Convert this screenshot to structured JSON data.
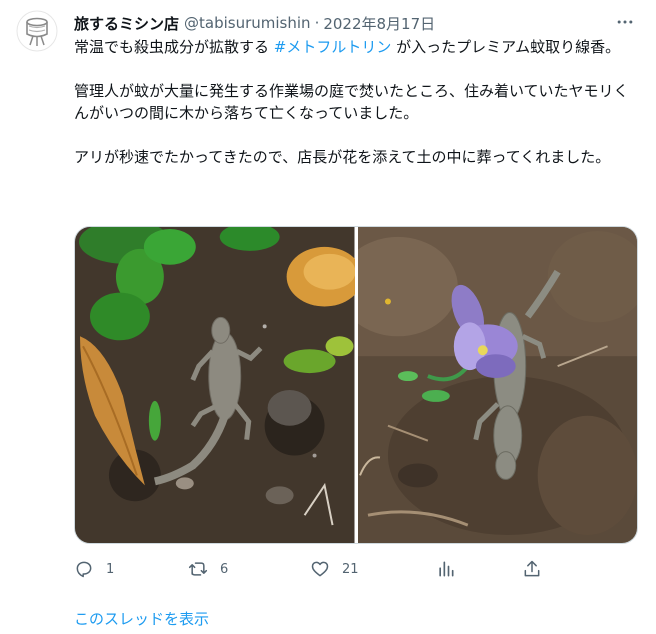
{
  "tweet": {
    "author": {
      "display_name": "旅するミシン店",
      "handle": "@tabisurumishin",
      "avatar_icon": "sewing-machine-logo-icon"
    },
    "separator": "·",
    "date": "2022年8月17日",
    "more_icon": "more-dots-icon",
    "text": {
      "p1_before": "常温でも殺虫成分が拡散する ",
      "p1_hashtag": "#メトフルトリン",
      "p1_after": " が入ったプレミアム蚊取り線香。",
      "p2": "管理人が蚊が大量に発生する作業場の庭で焚いたところ、住み着いていたヤモリくんがいつの間に木から落ちて亡くなっていました。",
      "p3": "アリが秒速でたかってきたので、店長が花を添えて土の中に葬ってくれました。"
    },
    "media": [
      {
        "name": "photo-gecko-on-ground",
        "icon": "photo"
      },
      {
        "name": "photo-gecko-with-flower",
        "icon": "photo"
      }
    ],
    "actions": {
      "reply": {
        "icon": "reply-icon",
        "count": "1"
      },
      "retweet": {
        "icon": "retweet-icon",
        "count": "6"
      },
      "like": {
        "icon": "heart-icon",
        "count": "21"
      },
      "stats": {
        "icon": "stats-icon"
      },
      "share": {
        "icon": "share-icon"
      }
    },
    "show_thread": "このスレッドを表示"
  },
  "colors": {
    "accent": "#1d9bf0",
    "text": "#0f1419",
    "secondary": "#536471"
  }
}
